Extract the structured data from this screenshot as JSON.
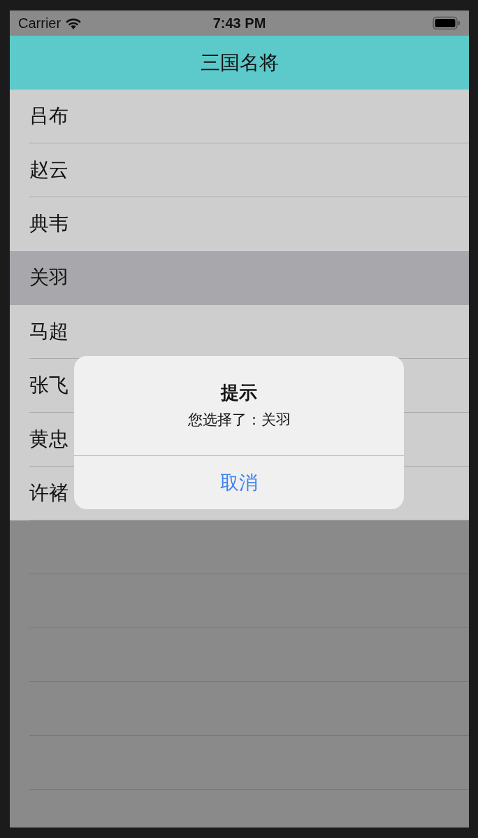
{
  "status_bar": {
    "carrier": "Carrier",
    "time": "7:43 PM"
  },
  "nav_bar": {
    "title": "三国名将"
  },
  "list": {
    "rows": [
      {
        "label": "吕布",
        "selected": false
      },
      {
        "label": "赵云",
        "selected": false
      },
      {
        "label": "典韦",
        "selected": false
      },
      {
        "label": "关羽",
        "selected": true
      },
      {
        "label": "马超",
        "selected": false
      },
      {
        "label": "张飞",
        "selected": false
      },
      {
        "label": "黄忠",
        "selected": false
      },
      {
        "label": "许褚",
        "selected": false
      }
    ]
  },
  "alert": {
    "title": "提示",
    "message": "您选择了：关羽",
    "buttons": [
      {
        "label": "取消"
      }
    ]
  }
}
